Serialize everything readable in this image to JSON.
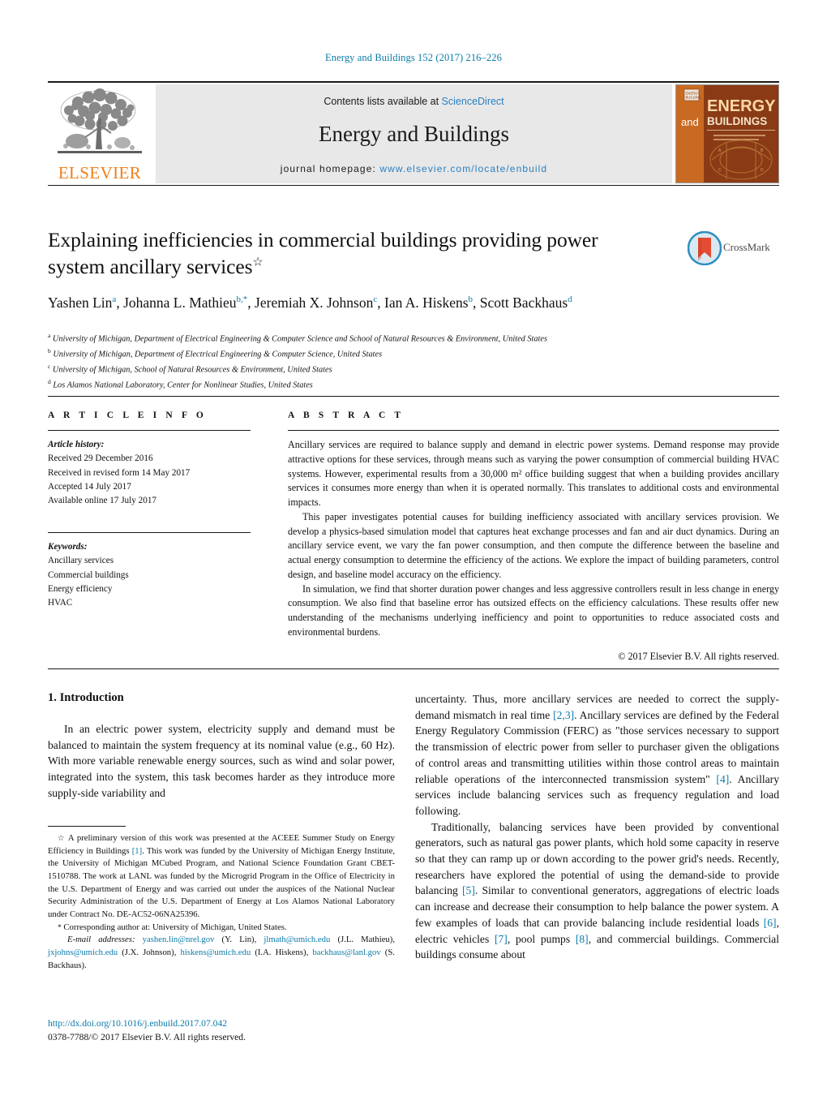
{
  "running_head": "Energy and Buildings 152 (2017) 216–226",
  "header": {
    "publisher_name": "ELSEVIER",
    "contents_prefix": "Contents lists available at ",
    "contents_link": "ScienceDirect",
    "journal_title": "Energy and Buildings",
    "homepage_prefix": "journal homepage: ",
    "homepage_url": "www.elsevier.com/locate/enbuild",
    "cover": {
      "line_and": "and",
      "line_energy": "ENERGY",
      "line_buildings": "BUILDINGS"
    }
  },
  "article": {
    "title": "Explaining inefficiencies in commercial buildings providing power system ancillary services",
    "title_star": "☆",
    "crossmark_label": "CrossMark",
    "authors_html": "Yashen Lin<sup>a</sup>, Johanna L. Mathieu<sup>b,*</sup>, Jeremiah X. Johnson<sup>c</sup>, Ian A. Hiskens<sup>b</sup>, Scott Backhaus<sup>d</sup>",
    "affiliations": [
      {
        "mark": "a",
        "text": "University of Michigan, Department of Electrical Engineering & Computer Science and School of Natural Resources & Environment, United States"
      },
      {
        "mark": "b",
        "text": "University of Michigan, Department of Electrical Engineering & Computer Science, United States"
      },
      {
        "mark": "c",
        "text": "University of Michigan, School of Natural Resources & Environment, United States"
      },
      {
        "mark": "d",
        "text": "Los Alamos National Laboratory, Center for Nonlinear Studies, United States"
      }
    ]
  },
  "article_info": {
    "heading": "A R T I C L E   I N F O",
    "history_label": "Article history:",
    "history": [
      "Received 29 December 2016",
      "Received in revised form 14 May 2017",
      "Accepted 14 July 2017",
      "Available online 17 July 2017"
    ],
    "keywords_label": "Keywords:",
    "keywords": [
      "Ancillary services",
      "Commercial buildings",
      "Energy efficiency",
      "HVAC"
    ]
  },
  "abstract": {
    "heading": "A B S T R A C T",
    "paragraphs": [
      "Ancillary services are required to balance supply and demand in electric power systems. Demand response may provide attractive options for these services, through means such as varying the power consumption of commercial building HVAC systems. However, experimental results from a 30,000 m² office building suggest that when a building provides ancillary services it consumes more energy than when it is operated normally. This translates to additional costs and environmental impacts.",
      "This paper investigates potential causes for building inefficiency associated with ancillary services provision. We develop a physics-based simulation model that captures heat exchange processes and fan and air duct dynamics. During an ancillary service event, we vary the fan power consumption, and then compute the difference between the baseline and actual energy consumption to determine the efficiency of the actions. We explore the impact of building parameters, control design, and baseline model accuracy on the efficiency.",
      "In simulation, we find that shorter duration power changes and less aggressive controllers result in less change in energy consumption. We also find that baseline error has outsized effects on the efficiency calculations. These results offer new understanding of the mechanisms underlying inefficiency and point to opportunities to reduce associated costs and environmental burdens."
    ],
    "copyright": "© 2017 Elsevier B.V. All rights reserved."
  },
  "body": {
    "section_heading": "1. Introduction",
    "left_paragraph": "In an electric power system, electricity supply and demand must be balanced to maintain the system frequency at its nominal value (e.g., 60 Hz). With more variable renewable energy sources, such as wind and solar power, integrated into the system, this task becomes harder as they introduce more supply-side variability and",
    "right_paragraph_1_a": "uncertainty. Thus, more ancillary services are needed to correct the supply-demand mismatch in real time ",
    "right_ref_23": "[2,3]",
    "right_paragraph_1_b": ". Ancillary services are defined by the Federal Energy Regulatory Commission (FERC) as \"those services necessary to support the transmission of electric power from seller to purchaser given the obligations of control areas and transmitting utilities within those control areas to maintain reliable operations of the interconnected transmission system\" ",
    "right_ref_4": "[4]",
    "right_paragraph_1_c": ". Ancillary services include balancing services such as frequency regulation and load following.",
    "right_paragraph_2_a": "Traditionally, balancing services have been provided by conventional generators, such as natural gas power plants, which hold some capacity in reserve so that they can ramp up or down according to the power grid's needs. Recently, researchers have explored the potential of using the demand-side to provide balancing ",
    "right_ref_5": "[5]",
    "right_paragraph_2_b": ". Similar to conventional generators, aggregations of electric loads can increase and decrease their consumption to help balance the power system. A few examples of loads that can provide balancing include residential loads ",
    "right_ref_6": "[6]",
    "right_paragraph_2_c": ", electric vehicles ",
    "right_ref_7": "[7]",
    "right_paragraph_2_d": ", pool pumps ",
    "right_ref_8": "[8]",
    "right_paragraph_2_e": ", and commercial buildings. Commercial buildings consume about"
  },
  "footnotes": {
    "star_mark": "☆",
    "funding_a": " A preliminary version of this work was presented at the ACEEE Summer Study on Energy Efficiency in Buildings ",
    "funding_ref": "[1]",
    "funding_b": ". This work was funded by the University of Michigan Energy Institute, the University of Michigan MCubed Program, and National Science Foundation Grant CBET-1510788. The work at LANL was funded by the Microgrid Program in the Office of Electricity in the U.S. Department of Energy and was carried out under the auspices of the National Nuclear Security Administration of the U.S. Department of Energy at Los Alamos National Laboratory under Contract No. DE-AC52-06NA25396.",
    "corresponding_mark": "*",
    "corresponding": " Corresponding author at: University of Michigan, United States.",
    "email_label": "E-mail addresses:",
    "emails": [
      {
        "address": "yashen.lin@nrel.gov",
        "name": " (Y. Lin), "
      },
      {
        "address": "jlmath@umich.edu",
        "name": " (J.L. Mathieu), "
      },
      {
        "address": "jxjohns@umich.edu",
        "name": " (J.X. Johnson), "
      },
      {
        "address": "hiskens@umich.edu",
        "name": " (I.A. Hiskens), "
      },
      {
        "address": "backhaus@lanl.gov",
        "name": " (S. Backhaus)."
      }
    ]
  },
  "footer": {
    "doi": "http://dx.doi.org/10.1016/j.enbuild.2017.07.042",
    "issn_line": "0378-7788/© 2017 Elsevier B.V. All rights reserved."
  },
  "colors": {
    "link_blue": "#0b7ba8",
    "sciencedirect_blue": "#2a7fc0",
    "elsevier_orange": "#f07f1a",
    "cover_brown": "#8a3b16",
    "cover_orange": "#c96a22"
  }
}
